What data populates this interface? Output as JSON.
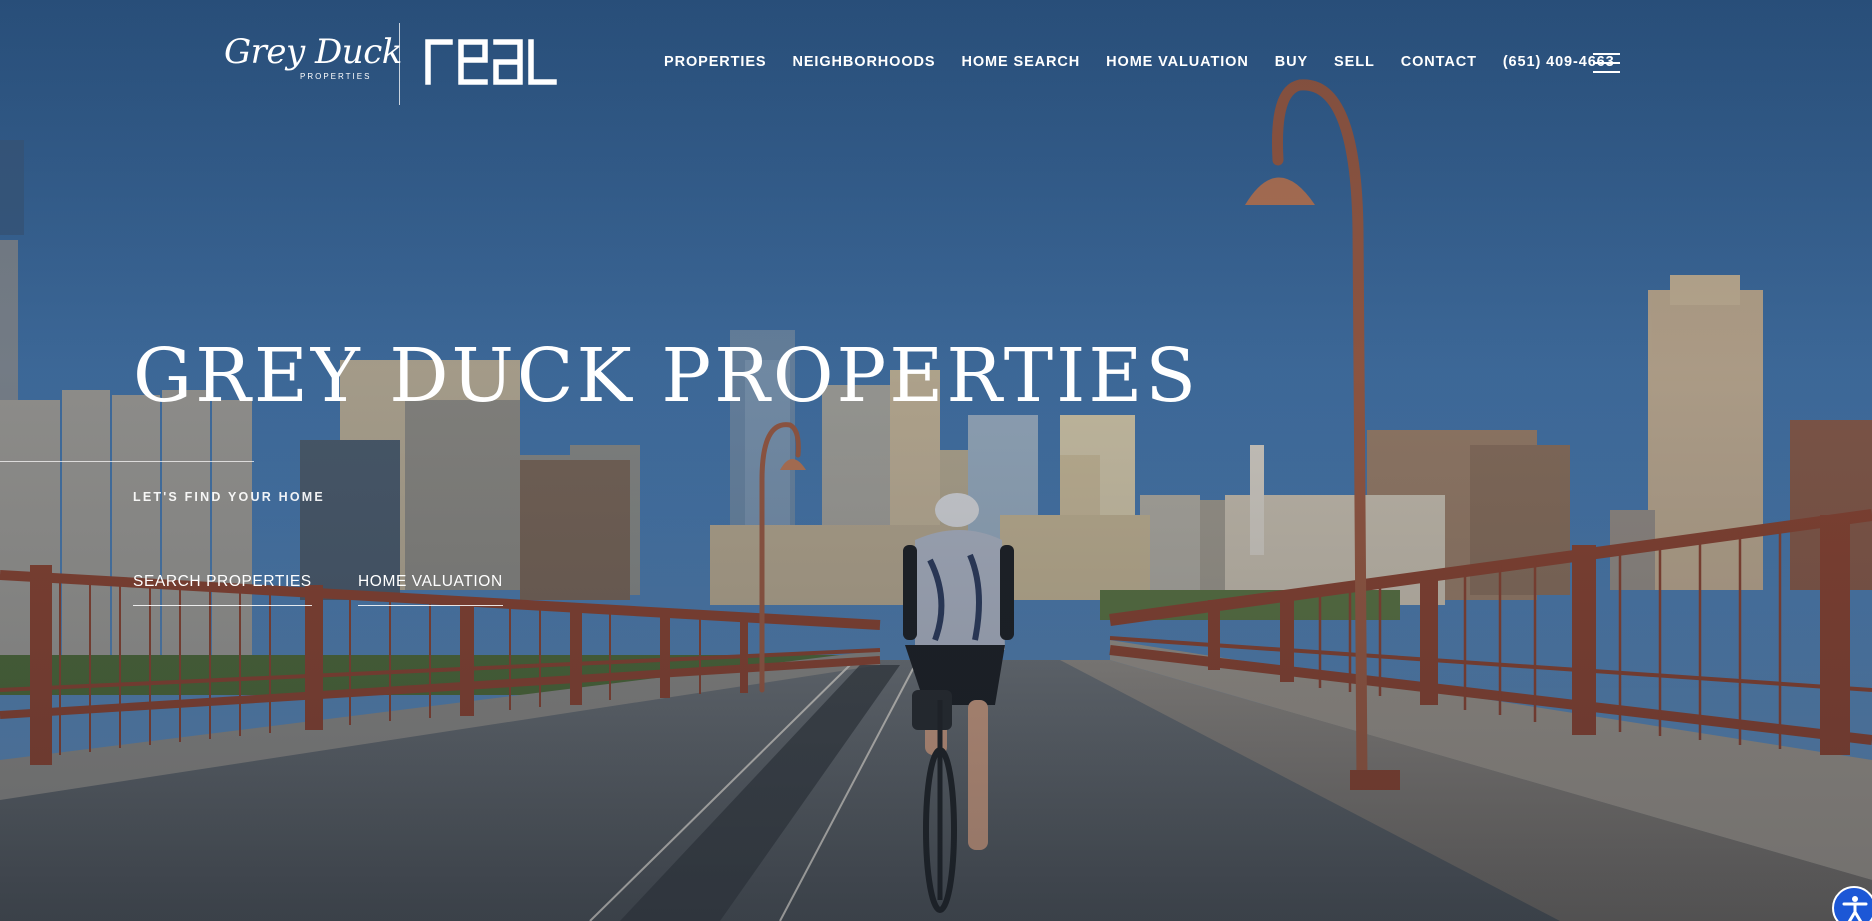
{
  "header": {
    "logo_primary": "Grey Duck",
    "logo_primary_sub": "PROPERTIES",
    "logo_secondary": "real",
    "nav": [
      {
        "label": "PROPERTIES"
      },
      {
        "label": "NEIGHBORHOODS"
      },
      {
        "label": "HOME SEARCH"
      },
      {
        "label": "HOME VALUATION"
      },
      {
        "label": "BUY"
      },
      {
        "label": "SELL"
      },
      {
        "label": "CONTACT"
      },
      {
        "label": "(651) 409-4663"
      }
    ],
    "menu_icon": "hamburger-menu-icon"
  },
  "hero": {
    "title": "GREY DUCK PROPERTIES",
    "tagline": "LET'S FIND YOUR HOME",
    "links": [
      {
        "label": "SEARCH PROPERTIES"
      },
      {
        "label": "HOME VALUATION"
      }
    ],
    "background": "cyclist on Stone Arch Bridge with Minneapolis skyline"
  },
  "accessibility": {
    "icon": "accessibility-icon",
    "color": "#1c57d6"
  },
  "colors": {
    "sky": "#3f6d9f",
    "railing": "#8a4533",
    "text": "#ffffff"
  }
}
